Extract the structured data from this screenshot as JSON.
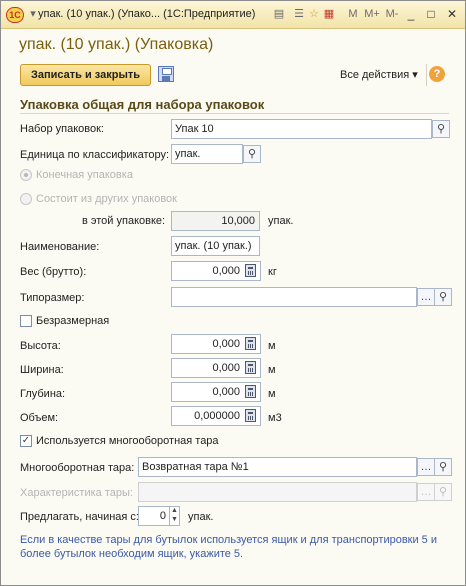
{
  "window": {
    "title": "упак. (10 упак.) (Упако... (1С:Предприятие)",
    "toolbar_icons": [
      "doc-icon",
      "list-icon",
      "star-icon",
      "calendar-icon"
    ],
    "memory_buttons": [
      "M",
      "M+",
      "M-"
    ],
    "minimize": "_",
    "maximize": "□",
    "close": "✕"
  },
  "form": {
    "title": "упак. (10 упак.) (Упаковка)",
    "save_close_label": "Записать и закрыть",
    "all_actions_label": "Все действия ▾",
    "help_label": "?",
    "group_title": "Упаковка общая для набора упаковок"
  },
  "fields": {
    "set_label": "Набор упаковок:",
    "set_value": "Упак 10",
    "unit_label": "Единица по классификатору:",
    "unit_value": "упак.",
    "radio_final": "Конечная упаковка",
    "radio_composite": "Состоит из других упаковок",
    "in_pack_label": "в этой упаковке:",
    "in_pack_value": "10,000",
    "in_pack_unit": "упак.",
    "name_label": "Наименование:",
    "name_value": "упак. (10 упак.)",
    "weight_label": "Вес (брутто):",
    "weight_value": "0,000",
    "weight_unit": "кг",
    "size_label": "Типоразмер:",
    "size_value": "",
    "dimensionless_label": "Безразмерная",
    "height_label": "Высота:",
    "height_value": "0,000",
    "height_unit": "м",
    "width_label": "Ширина:",
    "width_value": "0,000",
    "width_unit": "м",
    "depth_label": "Глубина:",
    "depth_value": "0,000",
    "depth_unit": "м",
    "volume_label": "Объем:",
    "volume_value": "0,000000",
    "volume_unit": "м3",
    "returnable_check_label": "Используется многооборотная тара",
    "returnable_label": "Многооборотная тара:",
    "returnable_value": "Возвратная тара №1",
    "characteristic_label": "Характеристика тары:",
    "characteristic_value": "",
    "offer_label": "Предлагать, начиная с:",
    "offer_value": "0",
    "offer_unit": "упак.",
    "note": "Если в качестве тары для бутылок используется ящик и для транспортировки 5 и более бутылок необходим ящик, укажите 5."
  }
}
